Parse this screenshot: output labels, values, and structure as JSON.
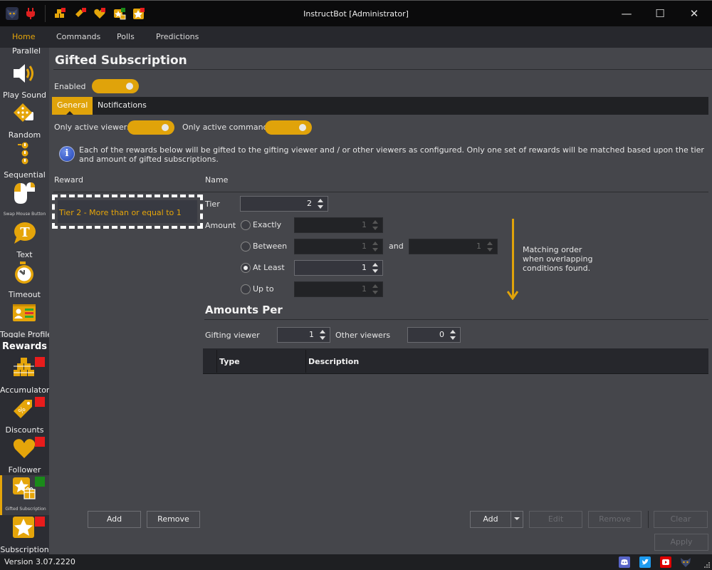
{
  "window": {
    "title": "InstructBot [Administrator]",
    "controls": {
      "minimize": "—",
      "maximize": "☐",
      "close": "✕"
    },
    "toolbar_icons": [
      "bot-logo",
      "plug",
      "accumulator",
      "discounts",
      "follower",
      "gifted-subscription",
      "subscription"
    ]
  },
  "menu": {
    "items": [
      {
        "label": "Home",
        "active": true
      },
      {
        "label": "Commands",
        "active": false
      },
      {
        "label": "Polls",
        "active": false
      },
      {
        "label": "Predictions",
        "active": false
      }
    ]
  },
  "sidebar": {
    "partial_top_label": "Parallel",
    "actions": [
      {
        "label": "Play Sound",
        "icon": "speaker"
      },
      {
        "label": "Random",
        "icon": "dice"
      },
      {
        "label": "Sequential",
        "icon": "sequence"
      },
      {
        "label": "Swap Mouse Button",
        "icon": "mouse"
      },
      {
        "label": "Text",
        "icon": "speech-bubble-t"
      },
      {
        "label": "Timeout",
        "icon": "stopwatch"
      },
      {
        "label": "Toggle Profile",
        "icon": "profile-card"
      }
    ],
    "rewards_header": "Rewards",
    "rewards": [
      {
        "label": "Accumulator",
        "icon": "gifts",
        "status": "red"
      },
      {
        "label": "Discounts",
        "icon": "tag",
        "status": "red"
      },
      {
        "label": "Follower",
        "icon": "heart",
        "status": "red"
      },
      {
        "label": "Gifted Subscription",
        "icon": "star-gift",
        "status": "green",
        "selected": true
      },
      {
        "label": "Subscription",
        "icon": "star",
        "status": "red"
      }
    ],
    "status_colors": {
      "red": "#e81c1c",
      "green": "#1a8a1a"
    }
  },
  "page": {
    "title": "Gifted Subscription",
    "enabled_label": "Enabled",
    "enabled": true,
    "tabs": [
      {
        "label": "General",
        "active": true
      },
      {
        "label": "Notifications",
        "active": false
      }
    ],
    "only_active_viewers_label": "Only active viewers",
    "only_active_viewers": true,
    "only_active_commands_label": "Only active commands",
    "only_active_commands": true,
    "info_text": "Each of the rewards below will be gifted to the gifting viewer and / or other viewers as configured. Only one set of rewards will be matched based upon the tier and amount of gifted subscriptions.",
    "reward_column": "Reward",
    "name_column": "Name",
    "rewards_list": [
      {
        "label": "Tier 2 - More than or equal to 1",
        "selected": true
      }
    ],
    "tier_label": "Tier",
    "tier_value": "2",
    "amount_label": "Amount",
    "amount_options": [
      {
        "label": "Exactly",
        "checked": false,
        "value": "1",
        "enabled": false
      },
      {
        "label": "Between",
        "checked": false,
        "value": "1",
        "enabled": false,
        "and_label": "and",
        "value2": "1"
      },
      {
        "label": "At Least",
        "checked": true,
        "value": "1",
        "enabled": true
      },
      {
        "label": "Up to",
        "checked": false,
        "value": "1",
        "enabled": false
      }
    ],
    "matching_note": "Matching order when overlapping conditions found.",
    "amounts_per_title": "Amounts Per",
    "gifting_viewer_label": "Gifting viewer",
    "gifting_viewer_value": "1",
    "other_viewers_label": "Other viewers",
    "other_viewers_value": "0",
    "table_columns": [
      "Type",
      "Description"
    ],
    "left_buttons": {
      "add": "Add",
      "remove": "Remove"
    },
    "right_buttons": {
      "add": "Add",
      "edit": "Edit",
      "remove": "Remove",
      "clear": "Clear",
      "apply": "Apply"
    }
  },
  "status": {
    "version": "Version 3.07.2220",
    "social_icons": [
      "discord",
      "twitter",
      "youtube",
      "bot-logo"
    ],
    "colors": {
      "discord": "#5865c8",
      "twitter": "#1d9bf0",
      "youtube": "#e00000"
    }
  },
  "theme": {
    "accent": "#e0a30a",
    "background": "#45464b",
    "sidebar": "#3b3c42",
    "titlebar": "#0b0b0c"
  }
}
